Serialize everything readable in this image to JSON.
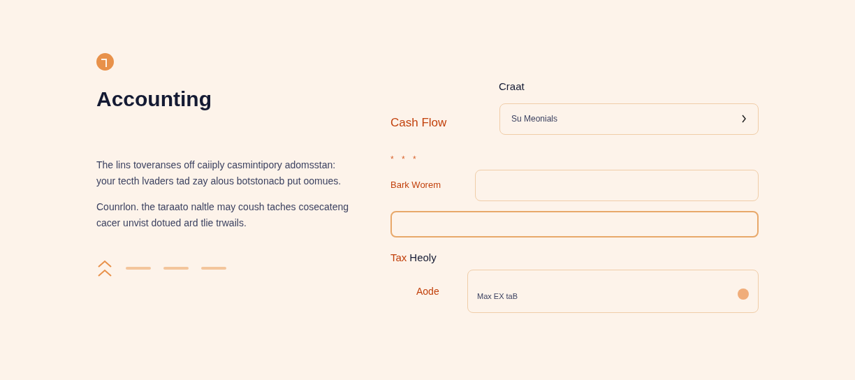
{
  "intro": {
    "title": "Accounting",
    "paragraphs": [
      "The lins toveranses off caiiply casmintipory adomsstan: your tecth lvaders tad zay alous botstonacb put oomues.",
      "Counrlon. the taraato naltle may coush taches cosecateng cacer unvist dotued ard tlie trwails."
    ]
  },
  "form": {
    "heading": "Craat",
    "cash_flow": {
      "label": "Cash Flow",
      "value": "Su Meonials"
    },
    "required_mark": "* * *",
    "bank": {
      "label": "Bark Worem"
    },
    "tax": {
      "prefix": "Tax",
      "label": "Heoly"
    },
    "amount": {
      "label": "Aode",
      "value": "Max EX taB"
    }
  }
}
